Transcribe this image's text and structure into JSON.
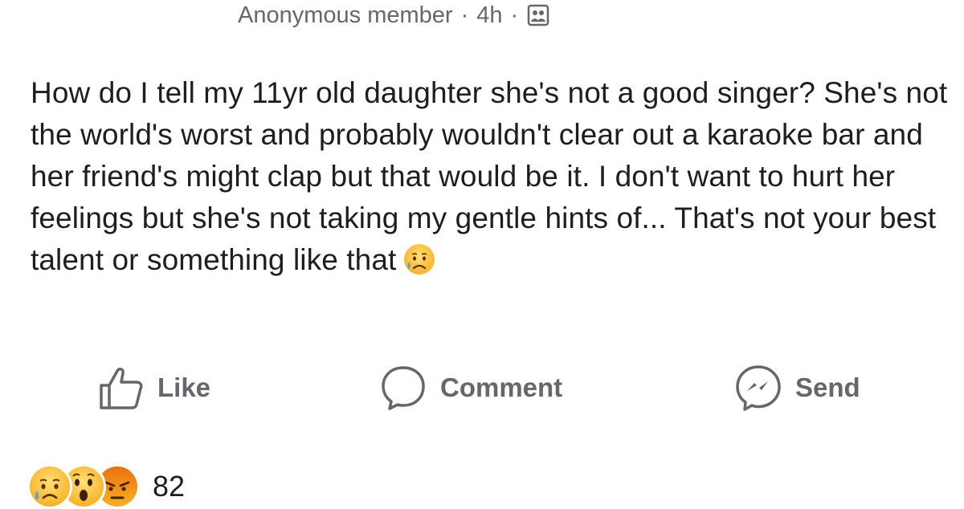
{
  "post": {
    "author": "Anonymous member",
    "time": "4h",
    "separator": "·",
    "audience_icon": "group-photo-icon",
    "text": "How do I tell my 11yr old daughter she's not a good singer? She's not the world's worst and probably wouldn't clear out a karaoke bar and her friend's might clap but that would be it. I don't want to hurt her feelings but she's not taking my gentle hints of... That's not your best talent or something like that",
    "inline_emoji": "sad-tear-emoji"
  },
  "actions": {
    "like_label": "Like",
    "comment_label": "Comment",
    "send_label": "Send"
  },
  "reactions": {
    "types": [
      "sad",
      "wow",
      "angry"
    ],
    "count": "82"
  },
  "colors": {
    "text": "#1c1e21",
    "muted": "#65676b",
    "emoji_yellow": "#f7b125",
    "angry_red": "#e9710f"
  }
}
